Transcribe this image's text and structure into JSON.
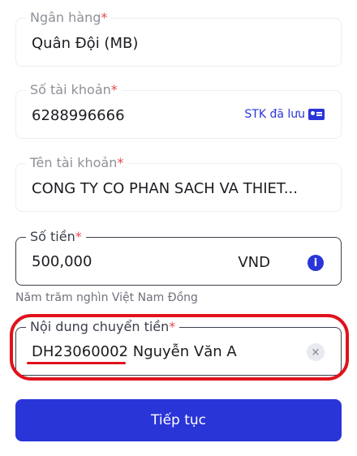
{
  "bank": {
    "label": "Ngân hàng",
    "required_mark": "*",
    "value": "Quân Đội (MB)"
  },
  "account_number": {
    "label": "Số tài khoản",
    "required_mark": "*",
    "value": "6288996666",
    "saved_link": "STK đã lưu",
    "saved_icon": "contact-card-icon"
  },
  "account_name": {
    "label": "Tên tài khoản",
    "required_mark": "*",
    "value": "CONG TY CO PHAN SACH VA THIET..."
  },
  "amount": {
    "label": "Số tiền",
    "required_mark": "*",
    "value": "500,000",
    "currency": "VND",
    "info_icon": "info-icon",
    "in_words": "Năm trăm nghìn Việt Nam Đồng"
  },
  "transfer_content": {
    "label": "Nội dung chuyển tiền",
    "required_mark": "*",
    "value": "DH23060002 Nguyễn Văn A",
    "clear_icon": "clear-icon"
  },
  "continue_button": "Tiếp tục",
  "colors": {
    "primary": "#2a35d8",
    "required": "#e5484d",
    "annotation": "#e0121c"
  }
}
